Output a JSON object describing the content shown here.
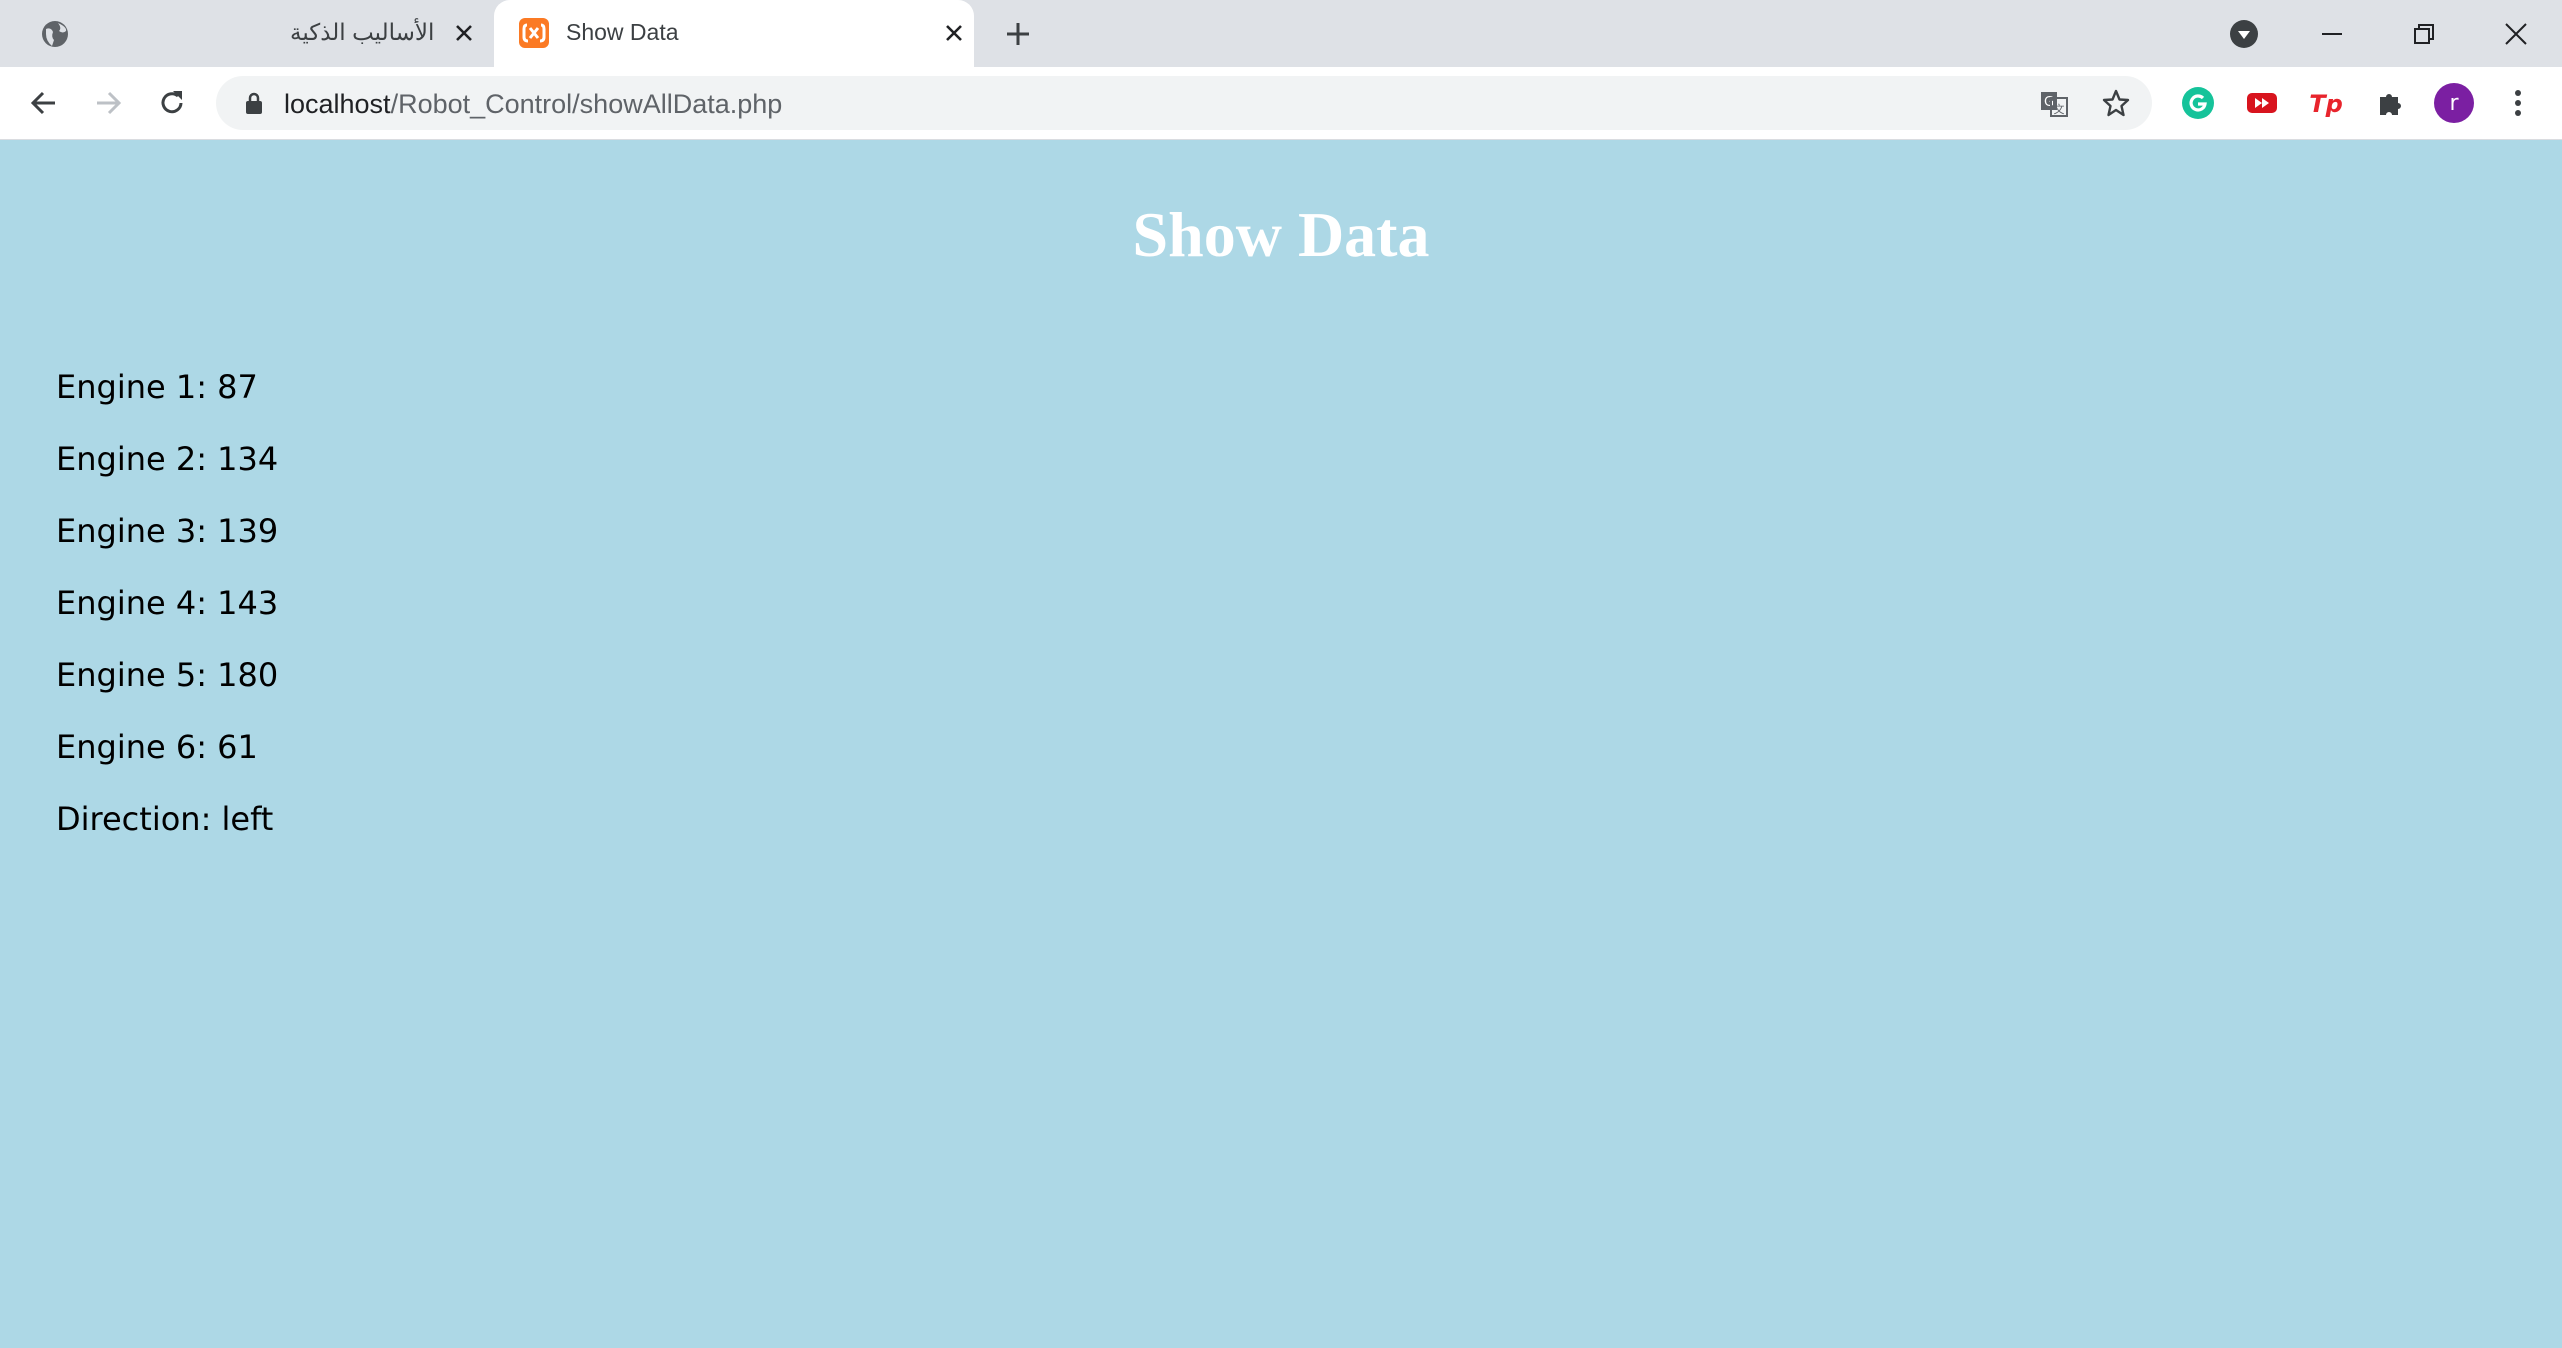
{
  "browser": {
    "tabs": [
      {
        "title": "الأساليب الذكية",
        "icon": "globe-icon",
        "active": false
      },
      {
        "title": "Show Data",
        "icon": "xampp-icon",
        "active": true
      }
    ],
    "url_host": "localhost",
    "url_path": "/Robot_Control/showAllData.php",
    "profile_initial": "r"
  },
  "page": {
    "title": "Show Data",
    "background_color": "#ADD8E6",
    "rows": [
      {
        "label": "Engine 1:",
        "value": "87"
      },
      {
        "label": "Engine 2:",
        "value": "134"
      },
      {
        "label": "Engine 3:",
        "value": "139"
      },
      {
        "label": "Engine 4:",
        "value": "143"
      },
      {
        "label": "Engine 5:",
        "value": "180"
      },
      {
        "label": "Engine 6:",
        "value": "61"
      },
      {
        "label": "Direction:",
        "value": "left"
      }
    ]
  }
}
